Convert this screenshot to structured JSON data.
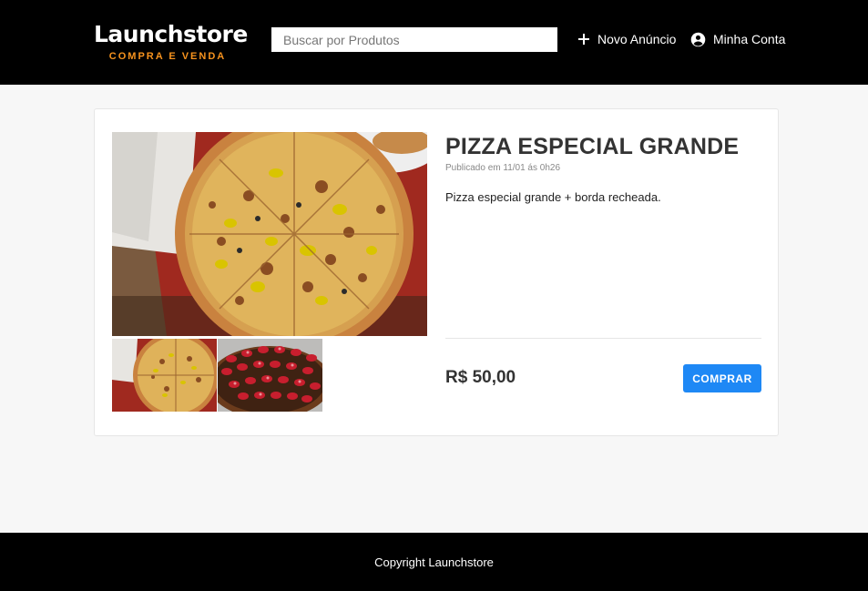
{
  "header": {
    "logo_name": "Launchstore",
    "logo_tagline": "COMPRA E VENDA",
    "search_placeholder": "Buscar por Produtos",
    "new_ad_label": "Novo Anúncio",
    "account_label": "Minha Conta",
    "new_ad_icon": "plus-icon",
    "account_icon": "account-circle-icon"
  },
  "product": {
    "title": "PIZZA ESPECIAL GRANDE",
    "published": "Publicado em 11/01 ás 0h26",
    "description": "Pizza especial grande + borda recheada.",
    "price": "R$ 50,00",
    "buy_label": "COMPRAR",
    "images": [
      "pizza-photo",
      "strawberry-tart-photo"
    ]
  },
  "footer": {
    "copyright": "Copyright Launchstore"
  },
  "colors": {
    "header_bg": "#000000",
    "tagline": "#f7931e",
    "buy_button": "#1e88f5",
    "page_bg": "#f7f7f7"
  }
}
